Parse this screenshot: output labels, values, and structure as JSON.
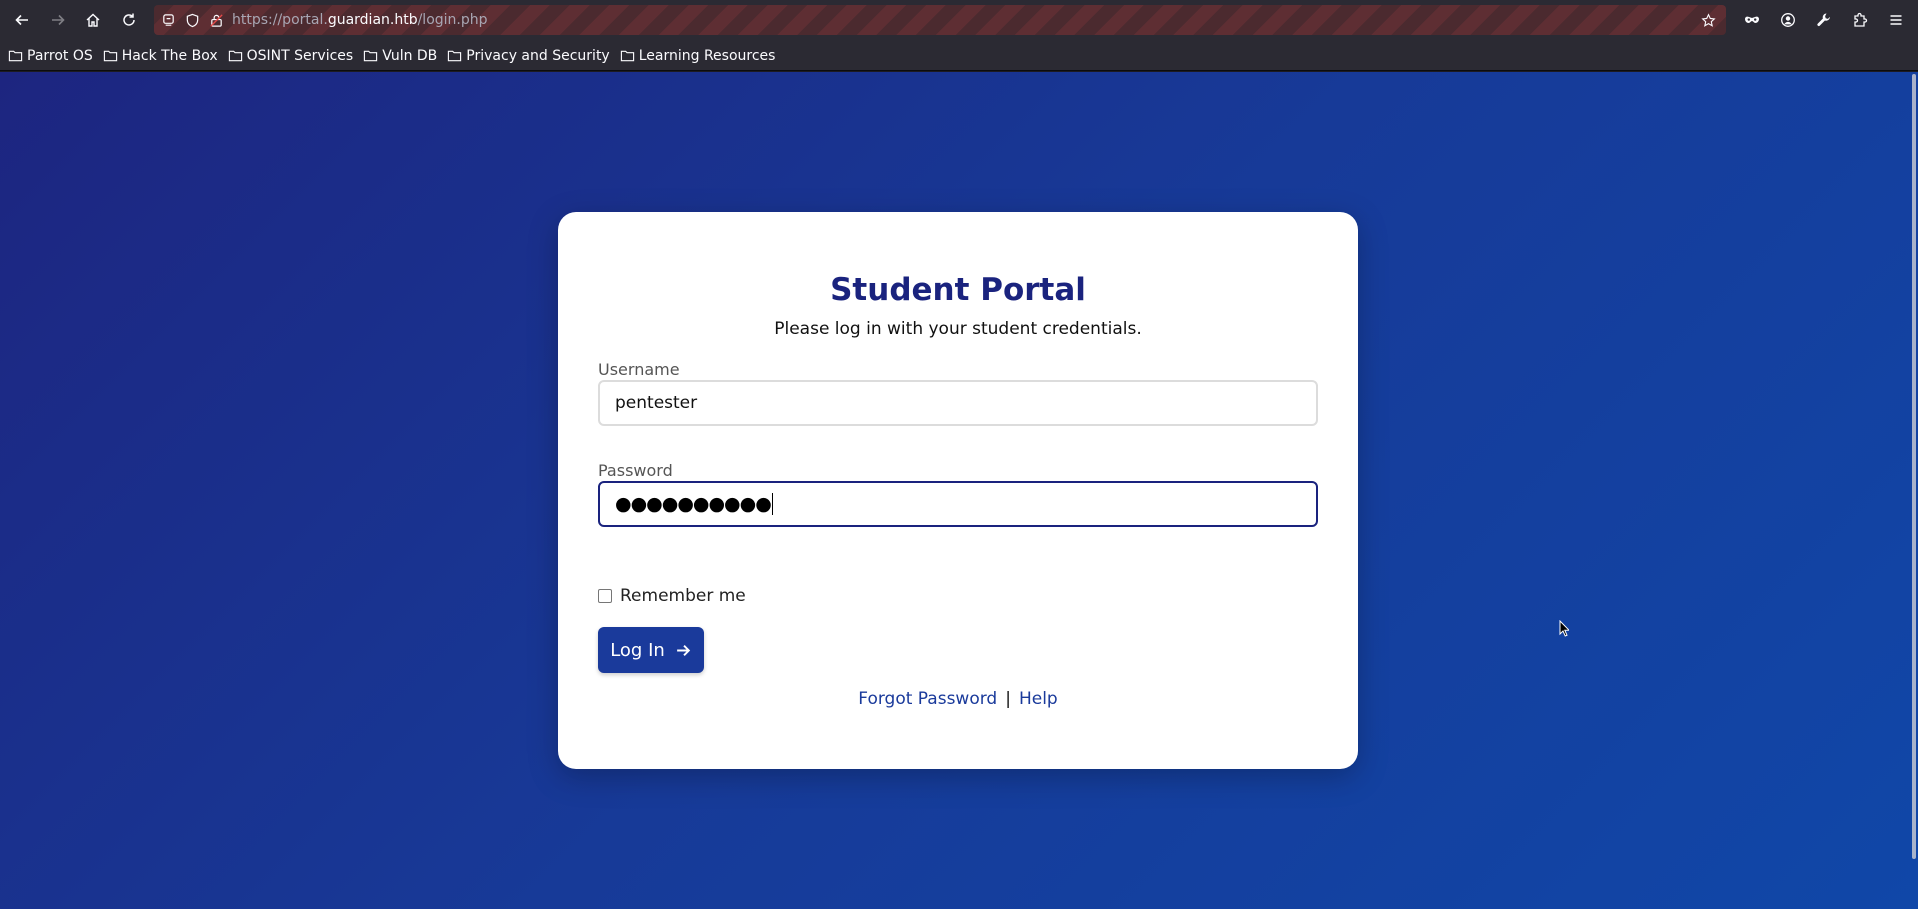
{
  "browser": {
    "url_prefix": "https://portal.",
    "url_domain": "guardian.htb",
    "url_path": "/login.php",
    "bookmarks": [
      {
        "label": "Parrot OS"
      },
      {
        "label": "Hack The Box"
      },
      {
        "label": "OSINT Services"
      },
      {
        "label": "Vuln DB"
      },
      {
        "label": "Privacy and Security"
      },
      {
        "label": "Learning Resources"
      }
    ]
  },
  "login": {
    "title": "Student Portal",
    "subtitle": "Please log in with your student credentials.",
    "username_label": "Username",
    "username_value": "pentester",
    "password_label": "Password",
    "password_masked": "●●●●●●●●●●",
    "remember_label": "Remember me",
    "remember_checked": false,
    "login_button": "Log In",
    "forgot_link": "Forgot Password",
    "separator": "|",
    "help_link": "Help"
  },
  "colors": {
    "accent": "#1a237e",
    "button": "#1a3a9b",
    "background_start": "#1d2580",
    "background_end": "#1047a8"
  }
}
